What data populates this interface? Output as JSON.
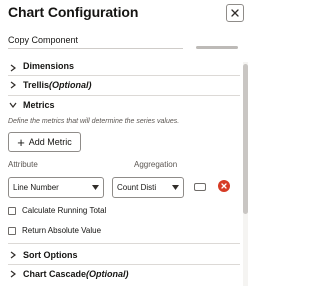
{
  "panel": {
    "title": "Chart Configuration",
    "close_label": "×"
  },
  "copy_component": {
    "label": "Copy Component"
  },
  "sections": {
    "dimensions": "Dimensions",
    "trellis": "Trellis",
    "trellis_optional": "(Optional)",
    "metrics": "Metrics",
    "sort_options": "Sort Options",
    "chart_cascade": "Chart Cascade",
    "chart_cascade_optional": "(Optional)"
  },
  "metrics": {
    "description": "Define the metrics that will determine the series values.",
    "add_button": "Add Metric",
    "attribute_header": "Attribute",
    "aggregation_header": "Aggregation",
    "attribute_value": "Line Number",
    "aggregation_value": "Count Disti",
    "calc_running_total": "Calculate Running Total",
    "return_absolute": "Return Absolute Value"
  },
  "colors": {
    "remove": "#d63b25",
    "text": "#161513"
  }
}
